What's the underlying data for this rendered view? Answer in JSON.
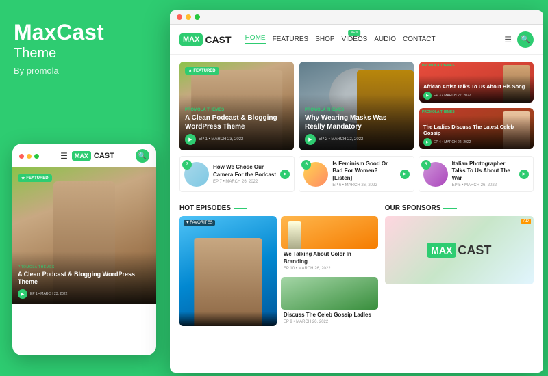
{
  "left": {
    "title": "MaxCast",
    "subtitle": "Theme",
    "by": "By promola",
    "mobile": {
      "logo_box": "MAX",
      "logo_text": "CAST",
      "featured_badge": "FEATURED",
      "promola": "PROMOLA THEMES",
      "title": "A Clean Podcast & Blogging WordPress Theme",
      "ep": "EP 1 • MARCH 23, 2022"
    }
  },
  "nav": {
    "logo_box": "MAX",
    "logo_text": "CAST",
    "links": [
      {
        "label": "HOME",
        "active": true
      },
      {
        "label": "FEATURES",
        "badge": ""
      },
      {
        "label": "SHOP",
        "badge": ""
      },
      {
        "label": "VIDEOS",
        "badge": "NEW"
      },
      {
        "label": "AUDIO",
        "badge": ""
      },
      {
        "label": "CONTACT",
        "badge": ""
      }
    ]
  },
  "hero_cards": [
    {
      "promola": "PROMOLA THEMES",
      "title": "A Clean Podcast & Blogging WordPress Theme",
      "ep": "EP 1 • MARCH 23, 2022",
      "featured": true
    },
    {
      "promola": "PROMOLA THEMES",
      "title": "Why Wearing Masks Was Really Mandatory",
      "ep": "EP 2 • MARCH 22, 2022",
      "featured": false
    }
  ],
  "right_cards": [
    {
      "promola": "PROMOLA THEMES",
      "title": "African Artist Talks To Us About His Song",
      "ep": "EP 3 • MARCH 22, 2022"
    },
    {
      "promola": "PROMOLA THEMES",
      "title": "The Ladies Discuss The Latest Celeb Gossip",
      "ep": "EP 4 • MARCH 22, 2022"
    }
  ],
  "episode_list": [
    {
      "num": "7",
      "title": "How We Chose Our Camera For the Podcast",
      "ep": "EP 7 • MARCH 26, 2022"
    },
    {
      "num": "6",
      "title": "Is Feminism Good Or Bad For Women? [Listen]",
      "ep": "EP 6 • MARCH 26, 2022"
    },
    {
      "num": "5",
      "title": "Italian Photographer Talks To Us About The War",
      "ep": "EP 5 • MARCH 26, 2022"
    }
  ],
  "hot_episodes": {
    "title": "HOT EPISODES",
    "cards": [
      {
        "favorites": true,
        "title": "",
        "ep": ""
      },
      {
        "title": "We Talking About Color In Branding",
        "ep": "EP 10 • MARCH 26, 2022"
      }
    ]
  },
  "sponsors": {
    "title": "OUR SPONSORS",
    "logo_box": "MAX",
    "logo_text": "CAST",
    "ad": "AD"
  },
  "browser_dots": [
    "#ff5f57",
    "#ffbd2e",
    "#28c840"
  ],
  "colors": {
    "green": "#2ecc71",
    "dark": "#222",
    "light_bg": "#f5f5f5"
  }
}
